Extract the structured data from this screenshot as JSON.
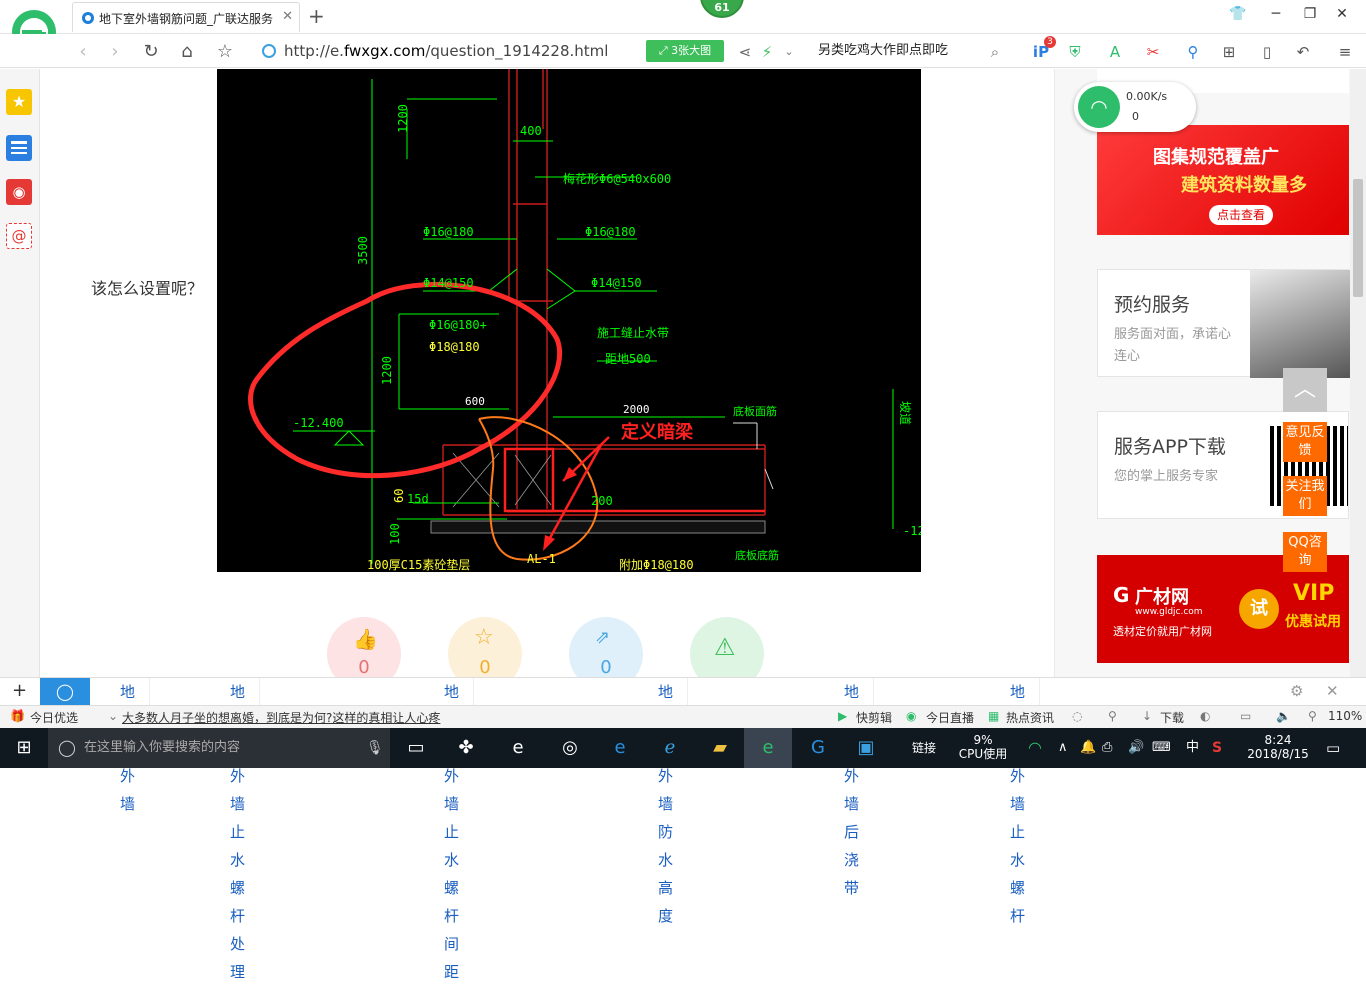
{
  "browser": {
    "tab_title": "地下室外墙钢筋问题_广联达服务",
    "badge_count": "61",
    "url_prefix": "http://e.",
    "url_domain": "fwxgx.com",
    "url_path": "/question_1914228.html",
    "image_count_label": "3张大图",
    "hot_search": "另类吃鸡大作即点即吃",
    "plugin_badge": "3"
  },
  "net_widget": {
    "speed": "0.00K/s",
    "count": "0"
  },
  "content": {
    "question_text": "该怎么设置呢？",
    "actions": [
      {
        "name": "like",
        "count": "0"
      },
      {
        "name": "favorite",
        "count": "0"
      },
      {
        "name": "share",
        "count": "0"
      },
      {
        "name": "report",
        "count": ""
      }
    ]
  },
  "cad": {
    "labels": {
      "dim_1200_top": "1200",
      "dim_400": "400",
      "plum": "梅花形Φ6@540x600",
      "left_16": "Φ16@180",
      "right_16": "Φ16@180",
      "dim_3500": "3500",
      "left_14": "Φ14@150",
      "right_14": "Φ14@150",
      "rebar_a": "Φ16@180+",
      "rebar_b": "Φ18@180",
      "waterstop_a": "施工缝止水带",
      "waterstop_b": "距地500",
      "dim_1200_mid": "1200",
      "elev": "-12.400",
      "dim_600": "600",
      "dim_2000": "2000",
      "slab_top": "底板面筋",
      "dark_beam": "定义暗梁",
      "dim_15d": "15d",
      "dim_200": "200",
      "dim_60": "60",
      "dim_100": "100",
      "cushion": "100厚C15素砼垫层",
      "ai_label": "AL-1",
      "added": "附加Φ18@180",
      "slab_bottom": "底板底筋",
      "edge_right": "坡道",
      "edge_right2": "-12"
    }
  },
  "sidebar_ads": {
    "banner1_line1": "图集规范覆盖广",
    "banner1_line2": "建筑资料数量多",
    "banner1_btn": "点击查看",
    "card1_title": "预约服务",
    "card1_sub": "服务面对面，承诺心连心",
    "card2_title": "服务APP下载",
    "card2_sub": "您的掌上服务专家",
    "banner2_brand": "广材网",
    "banner2_site": "www.gldjc.com",
    "banner2_slogan": "透材定价就用广材网",
    "banner2_try": "试",
    "banner2_vip": "VIP",
    "banner2_vip_sub": "优惠试用"
  },
  "float_buttons": {
    "feedback": "意见反馈",
    "follow": "关注我们",
    "qq": "QQ咨询"
  },
  "bottom_search": {
    "keywords": [
      "地下室外墙",
      "地下室外墙止水螺杆处理",
      "地下室外墙止水螺杆间距",
      "地下室外墙防水高度",
      "地下室外墙后浇带",
      "地下室外墙止水螺杆"
    ]
  },
  "status_bar": {
    "today_pick": "今日优选",
    "news": "大多数人月子坐的想离婚，到底是为何?这样的真相让人心疼",
    "quick_cut": "快剪辑",
    "live": "今日直播",
    "hot_news": "热点资讯",
    "download": "下载",
    "zoom": "110%"
  },
  "taskbar": {
    "search_placeholder": "在这里输入你要搜索的内容",
    "link": "链接",
    "cpu_percent": "9%",
    "cpu_label": "CPU使用",
    "ime": "中",
    "time": "8:24",
    "date": "2018/8/15"
  },
  "colors": {
    "accent_green": "#3fbf5c",
    "link_blue": "#1a5fc0",
    "float_orange": "#ff6a00",
    "cad_green": "#00ff00",
    "cad_yellow": "#ffff33",
    "annotation_red": "#ff2020"
  }
}
